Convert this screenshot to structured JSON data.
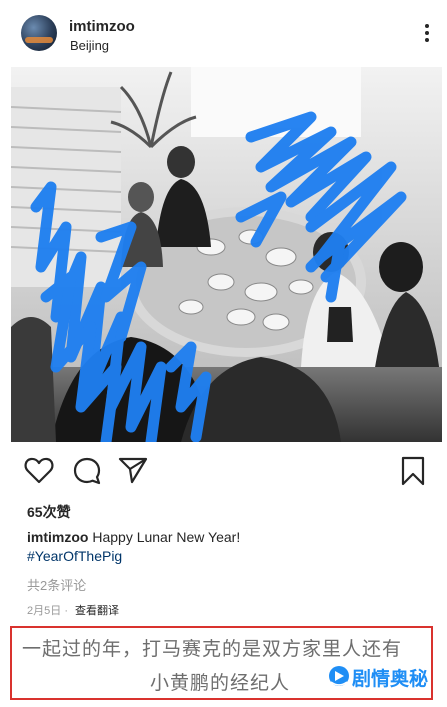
{
  "post": {
    "username": "imtimzoo",
    "location": "Beijing",
    "likes": "65次赞",
    "caption_user": "imtimzoo",
    "caption_text": "Happy Lunar New Year!",
    "hashtag": "#YearOfThePig",
    "comments": "共2条评论",
    "date": "2月5日",
    "date_sep": "·",
    "translate": "查看翻译"
  },
  "overlay": {
    "line1": "一起过的年，打马赛克的是双方家里人还有",
    "line2": "小黄鹏的经纪人",
    "watermark": "剧情奥秘"
  },
  "icons": {
    "avatar": "avatar-image",
    "more": "more-options-icon",
    "like": "heart-icon",
    "comment": "comment-bubble-icon",
    "share": "paper-plane-icon",
    "save": "bookmark-icon",
    "watermark_logo": "brand-logo-icon"
  },
  "colors": {
    "text": "#262626",
    "hashtag": "#003569",
    "muted": "#999999",
    "highlight_border": "#d9322e",
    "scribble": "#1f7ff0",
    "watermark": "#1f8ef5"
  }
}
